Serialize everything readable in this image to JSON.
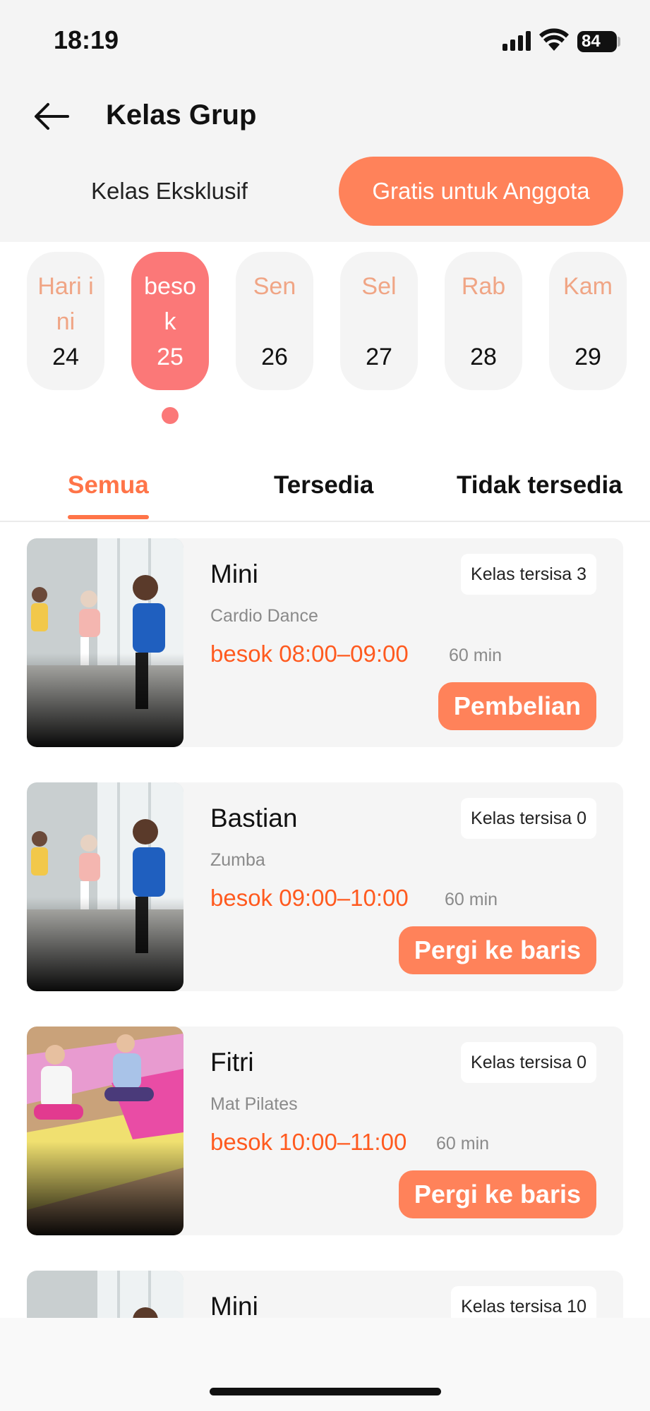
{
  "status_bar": {
    "time": "18:19",
    "battery": "84"
  },
  "header": {
    "title": "Kelas Grup"
  },
  "segments": {
    "exclusive": "Kelas Eksklusif",
    "free": "Gratis untuk Anggota"
  },
  "dates": [
    {
      "name": "Hari ini",
      "day": "24"
    },
    {
      "name": "besok",
      "day": "25"
    },
    {
      "name": "Sen",
      "day": "26"
    },
    {
      "name": "Sel",
      "day": "27"
    },
    {
      "name": "Rab",
      "day": "28"
    },
    {
      "name": "Kam",
      "day": "29"
    }
  ],
  "tabs": {
    "all": "Semua",
    "available": "Tersedia",
    "unavailable": "Tidak tersedia"
  },
  "classes": [
    {
      "title": "Mini",
      "type": "Cardio Dance",
      "time": "besok 08:00–09:00",
      "duration": "60 min",
      "remaining": "Kelas tersisa 3",
      "button": "Pembelian"
    },
    {
      "title": "Bastian",
      "type": "Zumba",
      "time": "besok 09:00–10:00",
      "duration": "60 min",
      "remaining": "Kelas tersisa 0",
      "button": "Pergi ke baris"
    },
    {
      "title": "Fitri",
      "type": "Mat Pilates",
      "time": "besok 10:00–11:00",
      "duration": "60 min",
      "remaining": "Kelas tersisa 0",
      "button": "Pergi ke baris"
    },
    {
      "title": "Mini",
      "remaining": "Kelas tersisa 10"
    }
  ],
  "colors": {
    "accent": "#ff825a",
    "date_active": "#fb7878",
    "time_text": "#ff5a1f"
  }
}
